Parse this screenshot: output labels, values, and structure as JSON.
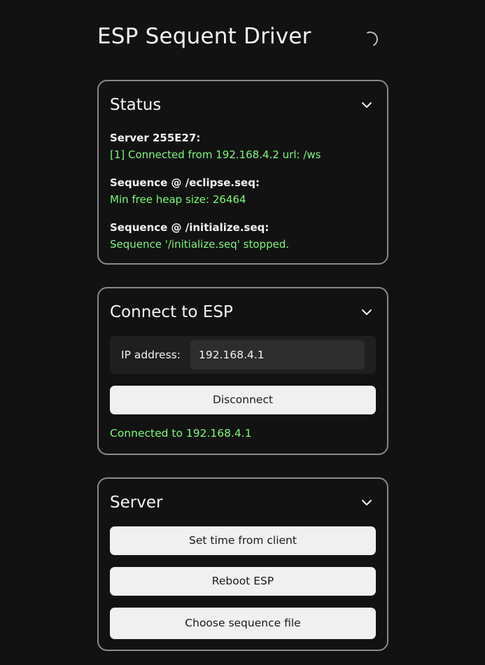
{
  "app": {
    "title": "ESP Sequent Driver"
  },
  "status_card": {
    "title": "Status",
    "entries": [
      {
        "label": "Server 255E27:",
        "value": "[1] Connected from 192.168.4.2 url: /ws"
      },
      {
        "label": "Sequence @ /eclipse.seq:",
        "value": "Min free heap size: 26464"
      },
      {
        "label": "Sequence @ /initialize.seq:",
        "value": "Sequence '/initialize.seq' stopped."
      }
    ]
  },
  "connect_card": {
    "title": "Connect to ESP",
    "ip_label": "IP address:",
    "ip_value": "192.168.4.1",
    "disconnect_label": "Disconnect",
    "connection_status": "Connected to 192.168.4.1"
  },
  "server_card": {
    "title": "Server",
    "set_time_label": "Set time from client",
    "reboot_label": "Reboot ESP",
    "choose_file_label": "Choose sequence file"
  },
  "colors": {
    "background": "#121212",
    "card_border": "#8a8a8a",
    "accent_green": "#7CF77C",
    "button_bg": "#f0f0f0"
  },
  "icons": {
    "collapse": "chevron-down-icon",
    "loading": "spinner-icon"
  }
}
